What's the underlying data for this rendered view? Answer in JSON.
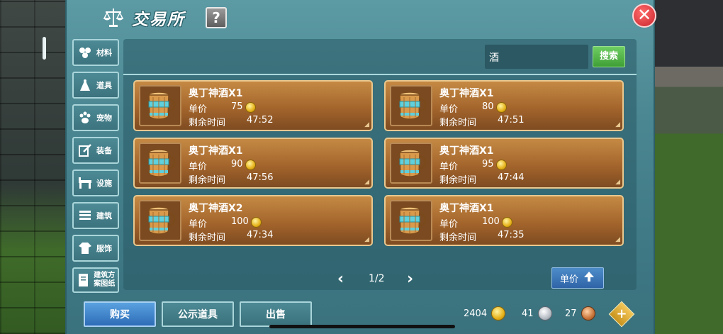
{
  "window": {
    "title": "交易所",
    "help_label": "?",
    "close_label": "✕"
  },
  "sidebar": {
    "items": [
      {
        "label": "材料",
        "icon": "materials-icon"
      },
      {
        "label": "道具",
        "icon": "props-icon"
      },
      {
        "label": "宠物",
        "icon": "pet-paw-icon"
      },
      {
        "label": "装备",
        "icon": "equipment-icon"
      },
      {
        "label": "设施",
        "icon": "facility-icon"
      },
      {
        "label": "建筑",
        "icon": "building-icon"
      },
      {
        "label": "服饰",
        "icon": "clothing-icon"
      },
      {
        "label": "建筑方案图纸",
        "icon": "blueprint-icon"
      }
    ]
  },
  "search": {
    "value": "酒",
    "button_label": "搜索"
  },
  "labels": {
    "price": "单价",
    "time_left": "剩余时间"
  },
  "listings": [
    {
      "name": "奥丁神酒X1",
      "price": "75",
      "time": "47:52"
    },
    {
      "name": "奥丁神酒X1",
      "price": "80",
      "time": "47:51"
    },
    {
      "name": "奥丁神酒X1",
      "price": "90",
      "time": "47:56"
    },
    {
      "name": "奥丁神酒X1",
      "price": "95",
      "time": "47:44"
    },
    {
      "name": "奥丁神酒X2",
      "price": "100",
      "time": "47:34"
    },
    {
      "name": "奥丁神酒X1",
      "price": "100",
      "time": "47:35"
    }
  ],
  "pagination": {
    "current": "1/2",
    "prev": "‹",
    "next": "›"
  },
  "sort": {
    "label": "单价"
  },
  "tabs": {
    "buy": "购买",
    "public": "公示道具",
    "sell": "出售"
  },
  "currency": {
    "gold": "2404",
    "silver": "41",
    "bronze": "27",
    "add": "+"
  },
  "colors": {
    "panel": "#4b8792",
    "card": "#a4652c",
    "buy_tab": "#2d6cb7",
    "search_btn": "#3f9f36"
  }
}
